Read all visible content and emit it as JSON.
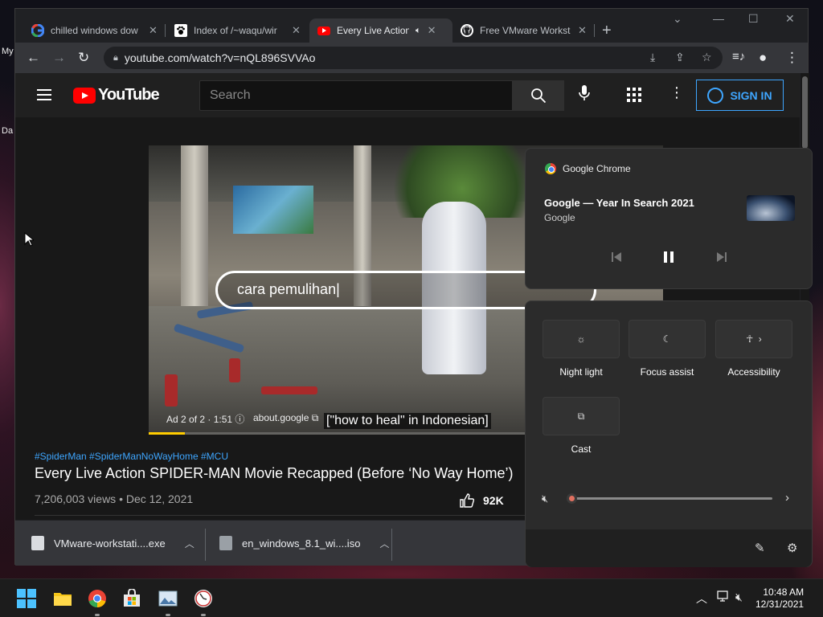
{
  "desktop": {
    "labels": [
      "My",
      "Da"
    ]
  },
  "tabs": [
    {
      "title": "chilled windows dow",
      "icon": "google-icon"
    },
    {
      "title": "Index of /~waqu/wir",
      "icon": "paw-icon"
    },
    {
      "title": "Every Live Action",
      "icon": "youtube-icon",
      "active": true,
      "audio": "speaker-icon"
    },
    {
      "title": "Free VMware Workst",
      "icon": "github-icon"
    }
  ],
  "omnibox": {
    "url": "youtube.com/watch?v=nQL896SVVAo"
  },
  "youtube": {
    "logo_text": "YouTube",
    "search_placeholder": "Search",
    "signin_label": "SIGN IN",
    "video": {
      "overlay_search_text": "cara pemulihan|",
      "caption": "[\"how to heal\" in Indonesian]",
      "ad_info": "Ad 2 of 2 · 1:51 ⓘ",
      "ad_site": "about.google ⧉",
      "progress": 0.07
    },
    "hashtags": "#SpiderMan #SpiderManNoWayHome #MCU",
    "title": "Every Live Action SPIDER-MAN Movie Recapped (Before ‘No Way Home’)",
    "meta": "7,206,003 views • Dec 12, 2021",
    "likes": "92K"
  },
  "downloads": [
    {
      "name": "VMware-workstati....exe"
    },
    {
      "name": "en_windows_8.1_wi....iso"
    }
  ],
  "media_flyout": {
    "source": "Google Chrome",
    "title": "Google — Year In Search 2021",
    "artist": "Google"
  },
  "quick_settings": {
    "tiles": [
      {
        "label": "Night light",
        "icon": "brightness-icon"
      },
      {
        "label": "Focus assist",
        "icon": "moon-icon"
      },
      {
        "label": "Accessibility",
        "icon": "accessibility-icon"
      },
      {
        "label": "Cast",
        "icon": "cast-icon"
      }
    ],
    "volume": 0.0
  },
  "taskbar": {
    "time": "10:48 AM",
    "date": "12/31/2021"
  }
}
